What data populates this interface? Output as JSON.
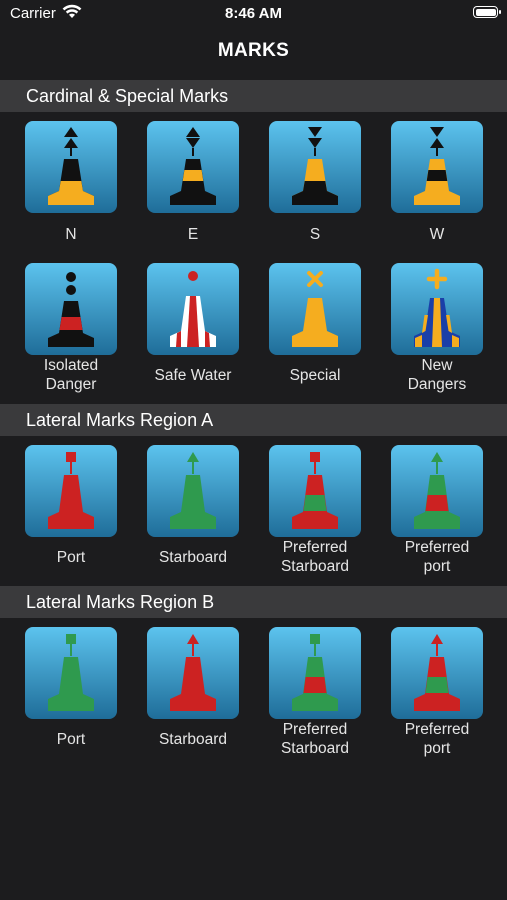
{
  "status_bar": {
    "carrier": "Carrier",
    "time": "8:46 AM"
  },
  "nav": {
    "title": "MARKS"
  },
  "sections": [
    {
      "title": "Cardinal & Special Marks",
      "items": [
        {
          "label": "N",
          "icon": "north-cardinal-icon"
        },
        {
          "label": "E",
          "icon": "east-cardinal-icon"
        },
        {
          "label": "S",
          "icon": "south-cardinal-icon"
        },
        {
          "label": "W",
          "icon": "west-cardinal-icon"
        },
        {
          "label": "Isolated\nDanger",
          "icon": "isolated-danger-icon"
        },
        {
          "label": "Safe Water",
          "icon": "safe-water-icon"
        },
        {
          "label": "Special",
          "icon": "special-mark-icon"
        },
        {
          "label": "New\nDangers",
          "icon": "new-danger-icon"
        }
      ]
    },
    {
      "title": "Lateral Marks  Region A",
      "items": [
        {
          "label": "Port",
          "icon": "port-mark-icon"
        },
        {
          "label": "Starboard",
          "icon": "starboard-mark-icon"
        },
        {
          "label": "Preferred\nStarboard",
          "icon": "preferred-starboard-icon"
        },
        {
          "label": "Preferred\nport",
          "icon": "preferred-port-icon"
        }
      ]
    },
    {
      "title": "Lateral Marks  Region B",
      "items": [
        {
          "label": "Port",
          "icon": "port-mark-icon"
        },
        {
          "label": "Starboard",
          "icon": "starboard-mark-icon"
        },
        {
          "label": "Preferred\nStarboard",
          "icon": "preferred-starboard-icon"
        },
        {
          "label": "Preferred\nport",
          "icon": "preferred-port-icon"
        }
      ]
    }
  ],
  "colors": {
    "background": "#1c1c1e",
    "section_header": "#3a3a3c",
    "tile_top": "#5cc3ee",
    "tile_bottom": "#1f6d99",
    "yellow": "#f5ad1f",
    "black": "#111111",
    "red": "#cc2222",
    "green": "#2f9a4e",
    "white": "#ffffff"
  }
}
